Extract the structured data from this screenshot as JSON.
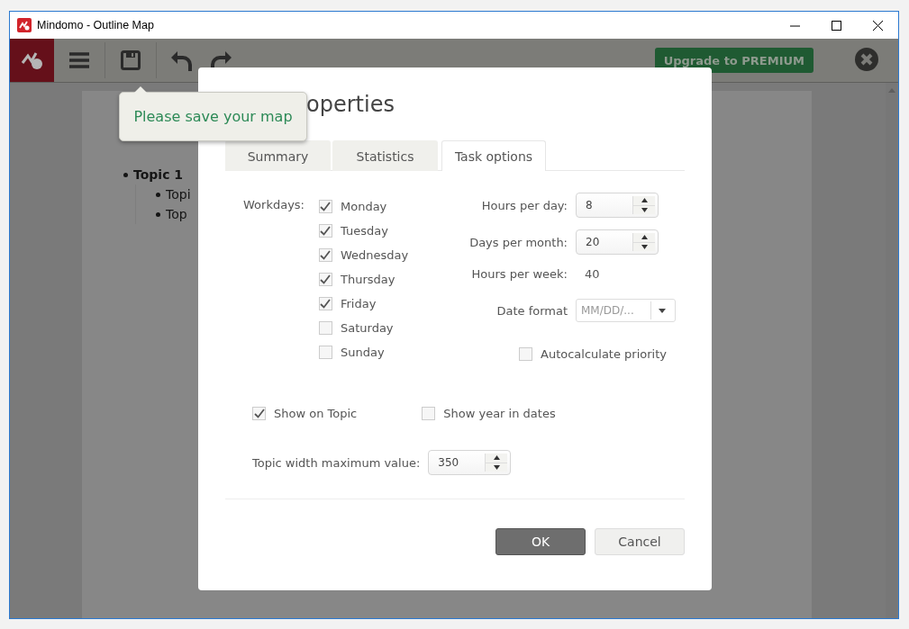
{
  "window": {
    "title": "Mindomo - Outline Map"
  },
  "toolbar": {
    "upgrade_button": "Upgrade to PREMIUM"
  },
  "outline": {
    "items": [
      {
        "text": "Topic 1",
        "children": [
          {
            "text": "Topi"
          },
          {
            "text": "Top"
          }
        ]
      }
    ]
  },
  "tooltip": {
    "text": "Please save your map"
  },
  "dialog": {
    "title": "operties",
    "tabs": [
      {
        "label": "Summary",
        "selected": false
      },
      {
        "label": "Statistics",
        "selected": false
      },
      {
        "label": "Task options",
        "selected": true
      }
    ],
    "workdays": {
      "label": "Workdays:",
      "days": [
        {
          "label": "Monday",
          "checked": true
        },
        {
          "label": "Tuesday",
          "checked": true
        },
        {
          "label": "Wednesday",
          "checked": true
        },
        {
          "label": "Thursday",
          "checked": true
        },
        {
          "label": "Friday",
          "checked": true
        },
        {
          "label": "Saturday",
          "checked": false
        },
        {
          "label": "Sunday",
          "checked": false
        }
      ]
    },
    "hours_per_day": {
      "label": "Hours per day:",
      "value": "8"
    },
    "days_per_month": {
      "label": "Days per month:",
      "value": "20"
    },
    "hours_per_week": {
      "label": "Hours per week:",
      "value": "40"
    },
    "date_format": {
      "label": "Date format",
      "value": "MM/DD/..."
    },
    "autocalculate_priority": {
      "label": "Autocalculate priority",
      "checked": false
    },
    "show_on_topic": {
      "label": "Show on Topic",
      "checked": true
    },
    "show_year_in_dates": {
      "label": "Show year in dates",
      "checked": false
    },
    "topic_width": {
      "label": "Topic width maximum value:",
      "value": "350"
    },
    "buttons": [
      {
        "label": "OK",
        "kind": "primary"
      },
      {
        "label": "Cancel",
        "kind": "secondary"
      }
    ]
  }
}
